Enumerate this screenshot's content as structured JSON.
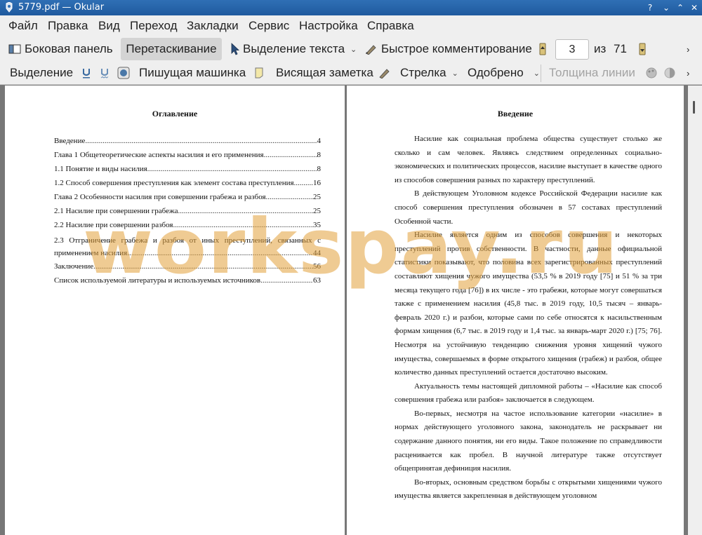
{
  "window": {
    "title": "5779.pdf  — Okular",
    "controls": {
      "help": "?",
      "minimize": "⌄",
      "maximize": "⌃",
      "close": "✕"
    }
  },
  "menu": [
    "Файл",
    "Правка",
    "Вид",
    "Переход",
    "Закладки",
    "Сервис",
    "Настройка",
    "Справка"
  ],
  "toolbar1": {
    "sidebar_label": "Боковая панель",
    "drag_label": "Перетаскивание",
    "text_select_label": "Выделение текста",
    "quick_comment_label": "Быстрое комментирование",
    "page_current": "3",
    "page_of": "из",
    "page_total": "71"
  },
  "toolbar2": {
    "highlight_label": "Выделение",
    "typewriter_label": "Пишущая машинка",
    "inline_note_label": "Висящая заметка",
    "arrow_label": "Стрелка",
    "approved_label": "Одобрено",
    "line_width_label": "Толщина линии"
  },
  "left_page": {
    "heading": "Оглавление",
    "toc": [
      {
        "title": "Введение",
        "page": "4"
      },
      {
        "title": "Глава 1 Общетеоретические аспекты насилия и его применения",
        "page": "8"
      },
      {
        "title": "1.1 Понятие и виды насилия",
        "page": "8"
      },
      {
        "title": "1.2 Способ совершения преступления как элемент состава преступления",
        "page": "16"
      },
      {
        "title": "Глава 2 Особенности насилия при совершении грабежа и разбоя",
        "page": "25"
      },
      {
        "title": "2.1 Насилие при совершении грабежа",
        "page": "25"
      },
      {
        "title": "2.2 Насилие при совершении разбоя",
        "page": "35"
      },
      {
        "title_line1": "2.3 Отграничение грабежа и разбоя от иных преступлений, связанных с",
        "title_line2": "применением насилия",
        "page": "44"
      },
      {
        "title": "Заключение",
        "page": "56"
      },
      {
        "title": "Список используемой литературы и используемых источников",
        "page": "63"
      }
    ]
  },
  "right_page": {
    "heading": "Введение",
    "paragraphs": [
      "Насилие как социальная проблема общества существует столько же сколько и сам человек. Являясь следствием определенных социально-экономических и политических процессов, насилие выступает в качестве одного из способов совершения разных по характеру преступлений.",
      "В действующем Уголовном кодексе Российской Федерации насилие как способ совершения преступления обозначен в 57 составах преступлений Особенной части.",
      "Насилие является одним из способов совершения и некоторых преступлений против собственности. В частности, данные официальной статистики показывают, что половина всех зарегистрированных преступлений составляют хищения чужого имущества (53,5 % в 2019 году [75] и 51 % за три месяца текущего года [76]) в их числе - это грабежи, которые могут совершаться также с применением насилия (45,8 тыс. в 2019 году, 10,5 тысяч – январь-февраль 2020 г.) и разбои, которые сами по себе относятся к насильственным формам хищения (6,7 тыс. в 2019 году и 1,4 тыс. за январь-март 2020 г.) [75; 76]. Несмотря на устойчивую тенденцию снижения уровня хищений чужого имущества, совершаемых в форме открытого хищения (грабеж) и разбоя, общее количество данных преступлений остается достаточно высоким.",
      "Актуальность темы настоящей дипломной работы – «Насилие как способ совершения грабежа или разбоя» заключается в следующем.",
      "Во-первых, несмотря на частое использование категории «насилие» в нормах действующего уголовного закона, законодатель не раскрывает ни содержание данного понятия, ни его виды. Такое положение по справедливости расценивается как пробел. В научной литературе также отсутствует общепринятая дефиниция насилия.",
      "Во-вторых, основным средством борьбы с открытыми хищениями чужого имущества является закрепленная в действующем уголовном"
    ]
  },
  "watermark": "workspay.ru"
}
